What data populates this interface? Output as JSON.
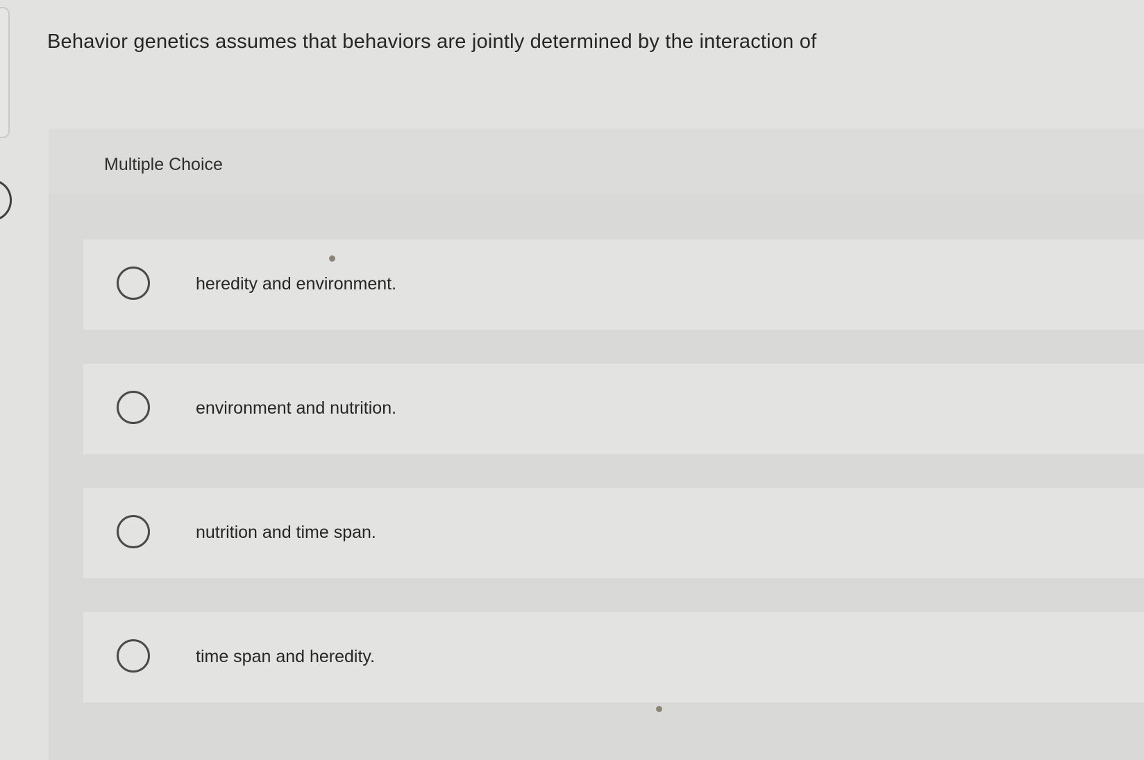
{
  "question": {
    "text": "Behavior genetics assumes that behaviors are jointly determined by the interaction of"
  },
  "multiple_choice": {
    "label": "Multiple Choice",
    "options": [
      {
        "label": "heredity and environment.",
        "selected": false
      },
      {
        "label": "environment and nutrition.",
        "selected": false
      },
      {
        "label": "nutrition and time span.",
        "selected": false
      },
      {
        "label": "time span and heredity.",
        "selected": false
      }
    ]
  },
  "colors": {
    "page_background": "#e2e2e1",
    "panel_background": "#d9d9d8",
    "option_background": "#e3e3e2",
    "text": "#262626",
    "radio_border": "#4a4a4a"
  }
}
